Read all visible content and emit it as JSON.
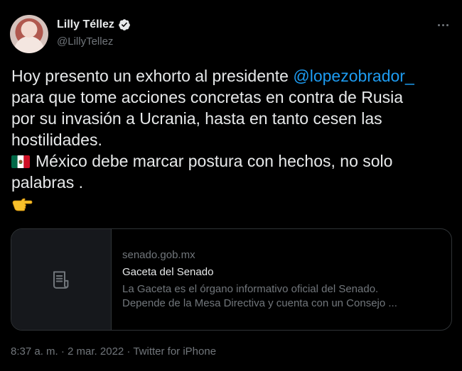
{
  "author": {
    "display_name": "Lilly Téllez",
    "handle": "@LillyTellez",
    "verified": true
  },
  "tweet": {
    "lines": [
      {
        "pre": "Hoy presento un exhorto al presidente ",
        "mention": "@lopezobrador_"
      },
      {
        "text": "para que tome acciones concretas en contra de Rusia"
      },
      {
        "text": "por su invasión a Ucrania, hasta en tanto cesen las"
      },
      {
        "text": "hostilidades."
      },
      {
        "text": "México debe marcar postura con hechos, no solo"
      },
      {
        "text": "palabras ."
      }
    ],
    "emoji": [
      "mexico-flag",
      "backhand-index-pointing-right"
    ]
  },
  "card": {
    "domain": "senado.gob.mx",
    "title": "Gaceta del Senado",
    "description_line1": "La Gaceta es el órgano informativo oficial del Senado.",
    "description_line2": "Depende de la Mesa Directiva y cuenta con un Consejo ..."
  },
  "meta": {
    "time": "8:37 a. m.",
    "separator": " · ",
    "date": "2 mar. 2022",
    "source": "Twitter for iPhone"
  },
  "colors": {
    "background": "#000000",
    "text": "#e7e9ea",
    "muted": "#71767b",
    "link": "#1d9bf0",
    "border": "#2f3336"
  }
}
